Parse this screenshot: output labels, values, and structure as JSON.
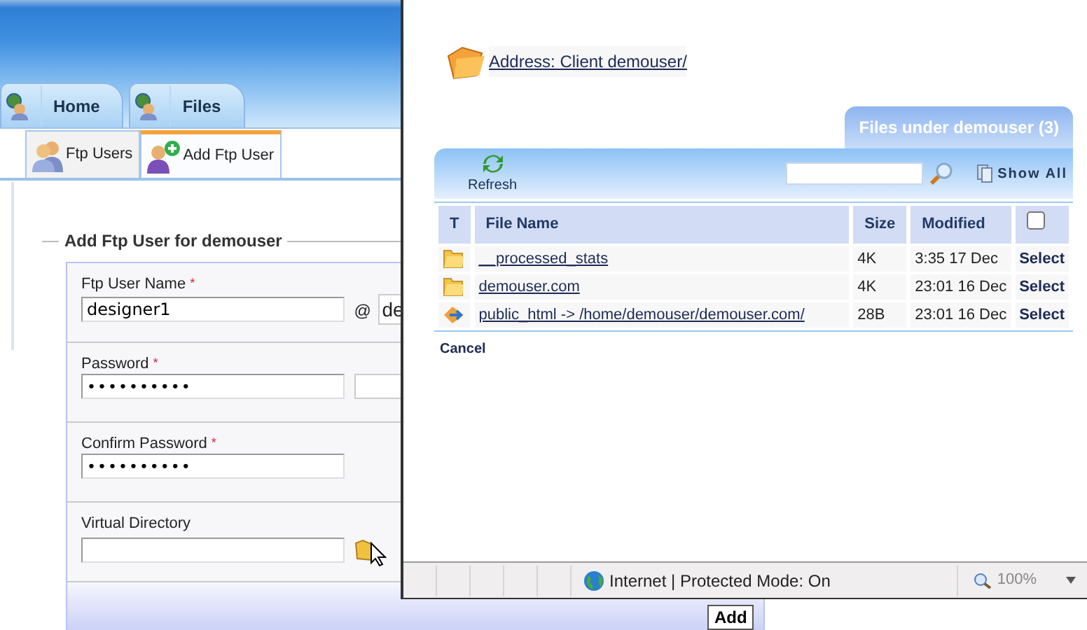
{
  "header_tabs": [
    {
      "label": "Home"
    },
    {
      "label": "Files"
    }
  ],
  "sub_tabs": [
    {
      "label": "Ftp Users",
      "selected": false
    },
    {
      "label": "Add Ftp User",
      "selected": true
    }
  ],
  "form": {
    "legend": "Add Ftp User for demouser",
    "fields": [
      {
        "kind": "user",
        "label": "Ftp User Name",
        "required_mark": "*",
        "value": "designer1",
        "at": "@",
        "domain": "de"
      },
      {
        "kind": "password",
        "label": "Password",
        "required_mark": "*",
        "value": "••••••••••"
      },
      {
        "kind": "password",
        "label": "Confirm Password",
        "required_mark": "*",
        "value": "••••••••••"
      },
      {
        "kind": "folder",
        "label": "Virtual Directory"
      }
    ]
  },
  "add_button": "Add",
  "popup": {
    "address": "Address: Client demouser/",
    "files_tab": "Files under demouser (3)",
    "toolbar": {
      "refresh": "Refresh",
      "show_all": "Show All"
    },
    "table": {
      "columns": [
        "T",
        "File Name",
        "Size",
        "Modified"
      ],
      "select_all_checked": false,
      "rows": [
        {
          "kind": "folder",
          "name": "__processed_stats",
          "size": "4K",
          "modified": "3:35 17 Dec",
          "action": "Select"
        },
        {
          "kind": "folder",
          "name": "demouser.com",
          "size": "4K",
          "modified": "23:01 16 Dec",
          "action": "Select"
        },
        {
          "kind": "link",
          "name": "public_html -> /home/demouser/demouser.com/",
          "size": "28B",
          "modified": "23:01 16 Dec",
          "action": "Select"
        }
      ]
    },
    "cancel": "Cancel",
    "status_bar": {
      "zone": "Internet | Protected Mode: On",
      "zoom": "100%"
    }
  }
}
